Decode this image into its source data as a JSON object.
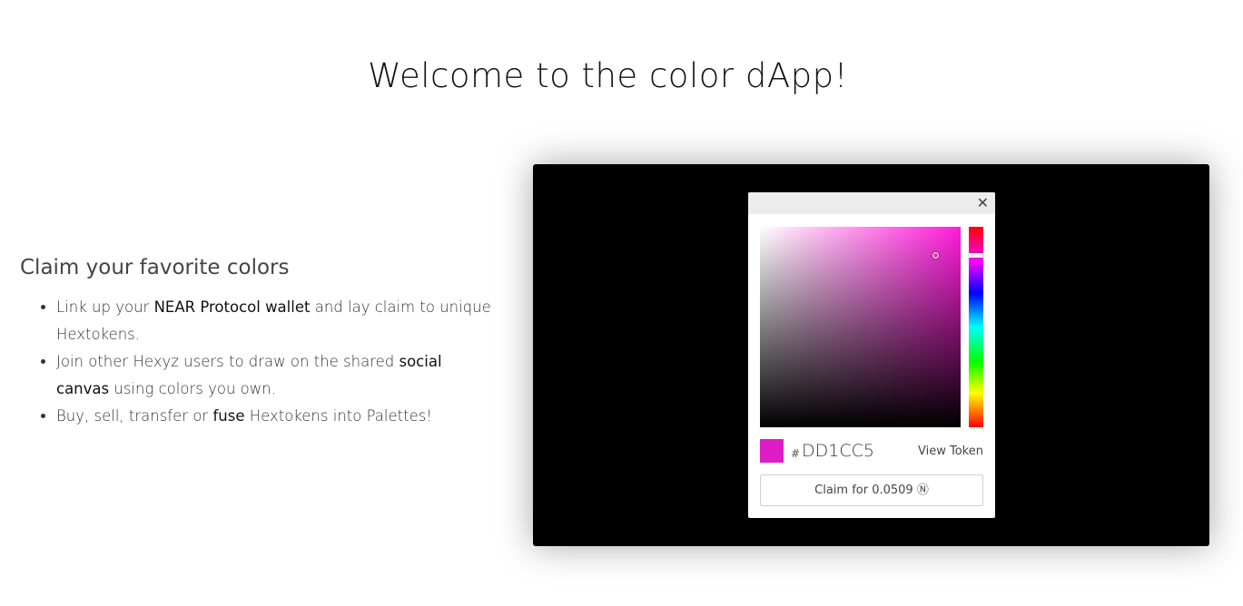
{
  "page": {
    "title": "Welcome to the color dApp!"
  },
  "intro": {
    "heading": "Claim your favorite colors",
    "items": [
      {
        "pre": "Link up your ",
        "bold": "NEAR Protocol wallet",
        "post": " and lay claim to unique Hextokens."
      },
      {
        "pre": "Join other Hexyz users to draw on the shared ",
        "bold": "social canvas",
        "post": " using colors you own."
      },
      {
        "pre": "Buy, sell, transfer or ",
        "bold": "fuse",
        "post": " Hextokens into Palettes!"
      }
    ]
  },
  "picker": {
    "close_icon": "close-icon",
    "hash_symbol": "#",
    "hex": "DD1CC5",
    "swatch_color": "#dd1cc5",
    "hue_color": "#ff1cdb",
    "view_token_label": "View Token",
    "claim_label": "Claim for 0.0509 Ⓝ"
  },
  "colors": {
    "panel_background": "#000000",
    "picker_header": "#ececec"
  }
}
